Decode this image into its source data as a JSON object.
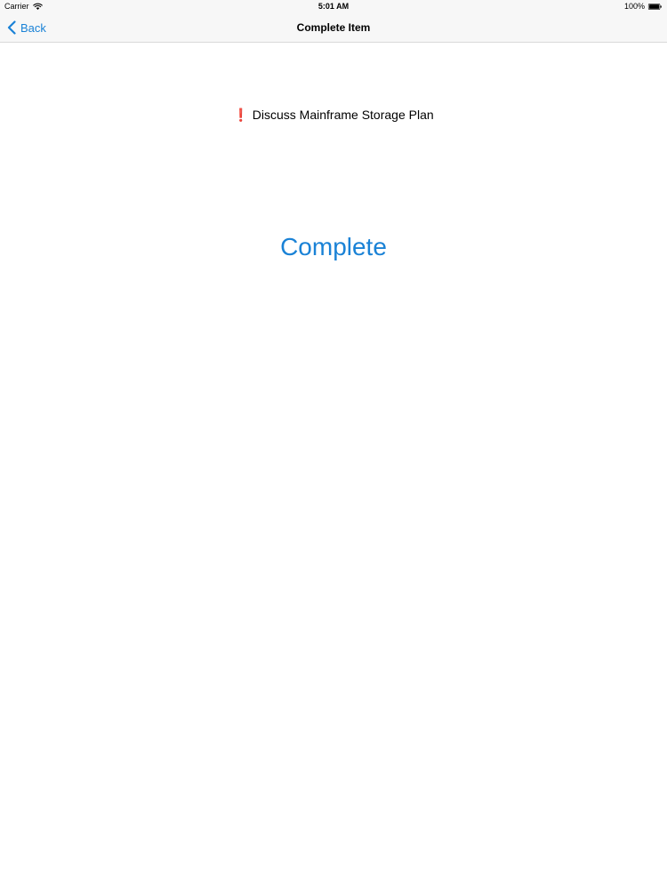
{
  "status_bar": {
    "carrier": "Carrier",
    "time": "5:01 AM",
    "battery": "100%"
  },
  "nav": {
    "back_label": "Back",
    "title": "Complete Item"
  },
  "item": {
    "icon": "exclamation-icon",
    "icon_glyph": "❗",
    "title": "Discuss Mainframe Storage Plan"
  },
  "actions": {
    "complete_label": "Complete"
  },
  "colors": {
    "accent": "#1a82d6",
    "alert": "#d0021b",
    "bar_background": "#f7f7f7"
  }
}
